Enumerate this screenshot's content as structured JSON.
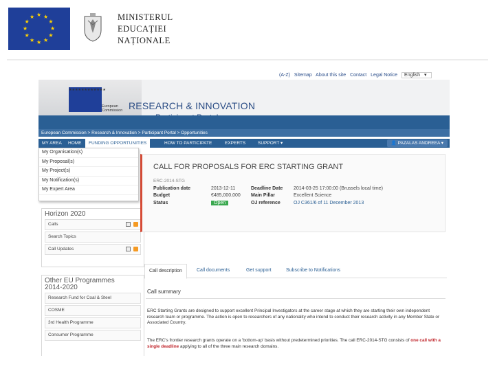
{
  "slide": {
    "ministry_lines": [
      "MINISTERUL",
      "EDUCAȚIEI",
      "NAȚIONALE"
    ]
  },
  "portal": {
    "top_links": [
      "(A-Z)",
      "Sitemap",
      "About this site",
      "Contact",
      "Legal Notice"
    ],
    "language": "English",
    "ec_label_1": "European",
    "ec_label_2": "Commission",
    "title": "RESEARCH & INNOVATION",
    "subtitle": "Participant Portal",
    "breadcrumb": "European Commission > Research & Innovation > Participant Portal > Opportunities",
    "nav": [
      "MY AREA",
      "HOME",
      "FUNDING OPPORTUNITIES",
      "HOW TO PARTICIPATE",
      "EXPERTS",
      "SUPPORT ▾"
    ],
    "user": "PAZALAS ANDREEA ▾",
    "my_area_menu": [
      "My Organisation(s)",
      "My Proposal(s)",
      "My Project(s)",
      "My Notification(s)",
      "My Expert Area"
    ]
  },
  "sidebar": {
    "horizon_title": "Horizon 2020",
    "horizon_items": [
      "Calls",
      "Search Topics",
      "Call Updates"
    ],
    "other_title_1": "Other EU Programmes",
    "other_title_2": "2014-2020",
    "other_items": [
      "Research Fund for Coal & Steel",
      "COSME",
      "3rd Health Programme",
      "Consumer Programme"
    ]
  },
  "call": {
    "title": "CALL FOR PROPOSALS FOR ERC STARTING GRANT",
    "id": "ERC-2014-STG",
    "pub_date_label": "Publication date",
    "pub_date": "2013-12-11",
    "budget_label": "Budget",
    "budget": "€485,000,000",
    "status_label": "Status",
    "status": "Open",
    "deadline_label": "Deadline Date",
    "deadline": "2014-03-25 17:00:00 (Brussels local time)",
    "pillar_label": "Main Pillar",
    "pillar": "Excellent Science",
    "oj_label": "OJ reference",
    "oj": "OJ C361/6 of 11 December 2013"
  },
  "tabs": [
    "Call description",
    "Call documents",
    "Get support",
    "Subscribe to Notifications"
  ],
  "summary": {
    "title": "Call summary",
    "p1": "ERC Starting Grants are designed to support excellent Principal Investigators at the career stage at which they are starting their own independent research team or programme. The action is open to researchers of any nationality who intend to conduct their research activity in any Member State or Associated Country.",
    "p2_a": "The ERC's frontier research grants operate on a 'bottom-up' basis without predetermined priorities. The call ERC-2014-STG consists of",
    "p2_red": "one call with a single deadline",
    "p2_b": "applying to all of the three main research domains."
  }
}
